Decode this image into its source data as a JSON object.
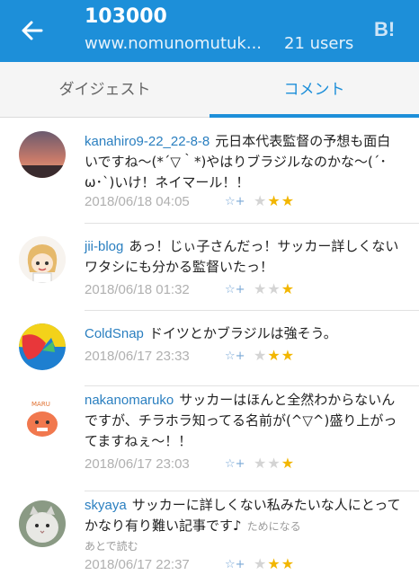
{
  "header": {
    "title": "103000",
    "url": "www.nomunomutuk...",
    "users": "21 users",
    "logo": "B!",
    "back_icon": "arrow-left-icon"
  },
  "tabs": [
    {
      "label": "ダイジェスト"
    },
    {
      "label": "コメント"
    }
  ],
  "comments": [
    {
      "user": "kanahiro9-22_22-8-8",
      "text": "元日本代表監督の予想も面白いですね〜(*´▽｀*)やはりブラジルなのかな〜(´･ω･`)いけ！ネイマール！！",
      "date": "2018/06/18 04:05",
      "stars": "2"
    },
    {
      "user": "jii-blog",
      "text": "あっ！じぃ子さんだっ！サッカー詳しくないワタシにも分かる監督いたっ！",
      "date": "2018/06/18 01:32",
      "stars": "1"
    },
    {
      "user": "ColdSnap",
      "text": "ドイツとかブラジルは強そう。",
      "date": "2018/06/17 23:33",
      "stars": "2"
    },
    {
      "user": "nakanomaruko",
      "text": "サッカーはほんと全然わからないんですが、チラホラ知ってる名前が(^▽^)盛り上がってますねぇ〜！！",
      "date": "2018/06/17 23:03",
      "stars": "1"
    },
    {
      "user": "skyaya",
      "text": "サッカーに詳しくない私みたいな人にとってかなり有り難い記事です♪",
      "tag1": "ためになる",
      "tag2": "あとで読む",
      "date": "2018/06/17 22:37",
      "stars": "2"
    }
  ],
  "colors": {
    "header_bg": "#1d8fd9",
    "accent": "#1d8fd9",
    "star": "#f2b600"
  }
}
